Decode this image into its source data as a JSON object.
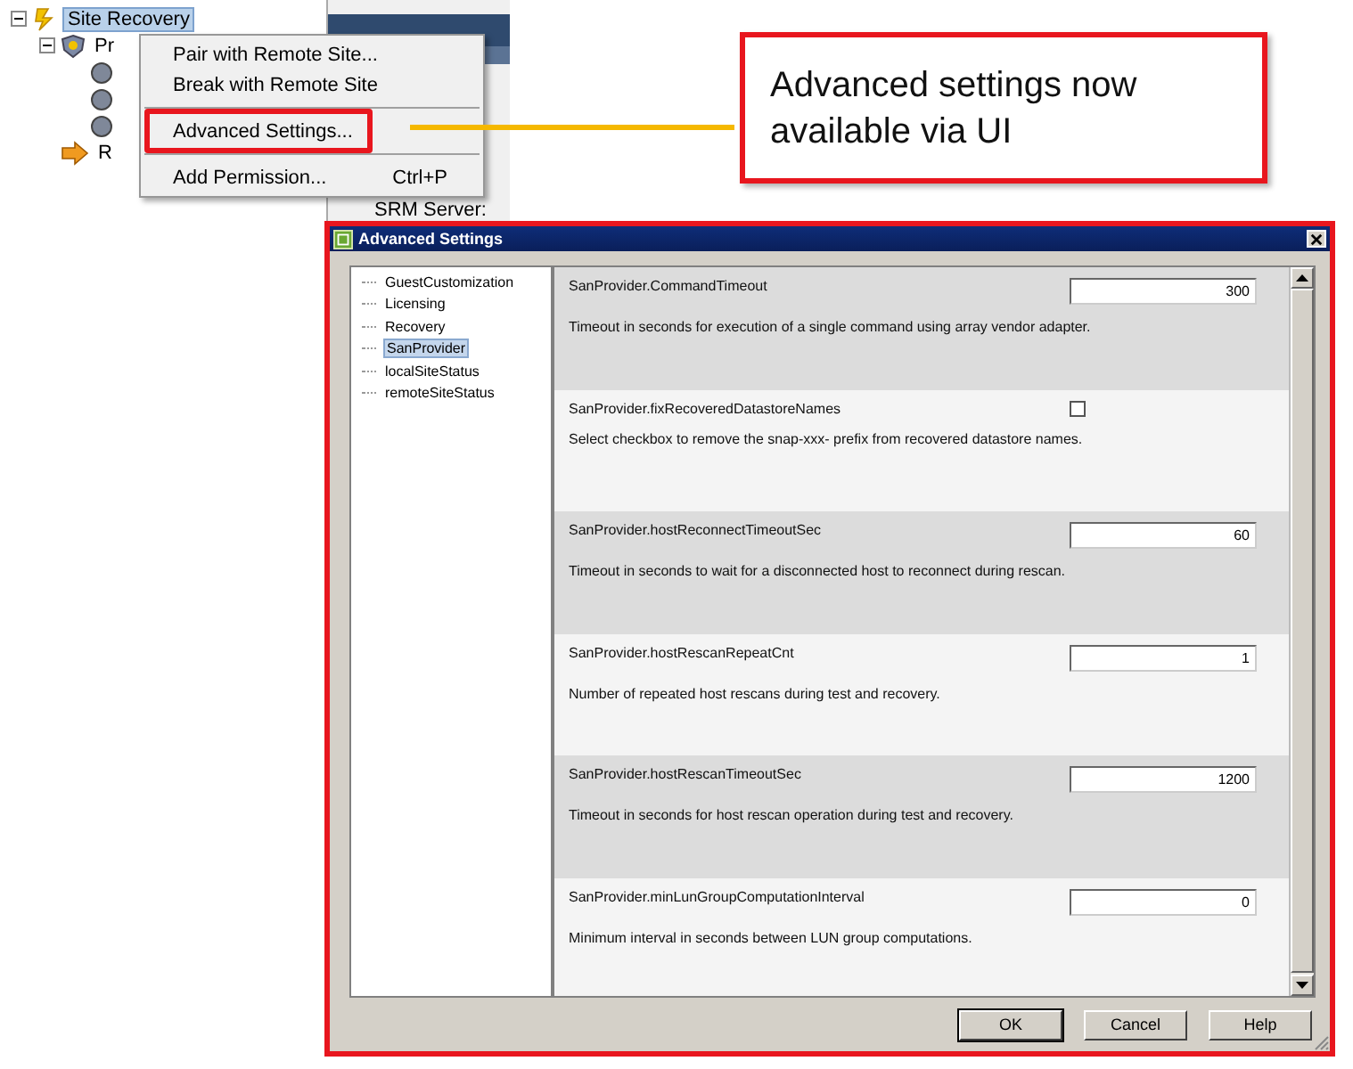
{
  "tree": {
    "items": [
      {
        "label": "Site Recovery",
        "kind": "site",
        "selected": true,
        "expanded": true,
        "children": [
          {
            "label": "Pr",
            "kind": "protection",
            "selected": false,
            "expanded": true,
            "children": [
              {
                "kind": "group"
              },
              {
                "kind": "group"
              },
              {
                "kind": "group"
              }
            ]
          },
          {
            "label": "R",
            "kind": "recovery",
            "selected": false
          }
        ]
      }
    ]
  },
  "info_panel": {
    "field_label": "SRM Server:"
  },
  "context_menu": {
    "items": [
      {
        "kind": "item",
        "label": "Pair with Remote Site...",
        "highlighted": false
      },
      {
        "kind": "item",
        "label": "Break with Remote Site",
        "highlighted": false
      },
      {
        "kind": "separator"
      },
      {
        "kind": "item",
        "label": "Advanced Settings...",
        "highlighted": true
      },
      {
        "kind": "separator"
      },
      {
        "kind": "item",
        "label": "Add Permission...",
        "shortcut": "Ctrl+P",
        "highlighted": false
      }
    ]
  },
  "callout": {
    "text": "Advanced settings now available via UI"
  },
  "dialog": {
    "title": "Advanced Settings",
    "categories": [
      {
        "label": "GuestCustomization",
        "selected": false
      },
      {
        "label": "Licensing",
        "selected": false
      },
      {
        "label": "Recovery",
        "selected": false
      },
      {
        "label": "SanProvider",
        "selected": true
      },
      {
        "label": "localSiteStatus",
        "selected": false
      },
      {
        "label": "remoteSiteStatus",
        "selected": false
      }
    ],
    "settings": [
      {
        "kind": "number",
        "name": "SanProvider.CommandTimeout",
        "value": "300",
        "description": "Timeout in seconds for execution of a single command using array vendor adapter."
      },
      {
        "kind": "checkbox",
        "name": "SanProvider.fixRecoveredDatastoreNames",
        "checked": false,
        "description": "Select checkbox to remove the snap-xxx- prefix from recovered datastore names."
      },
      {
        "kind": "number",
        "name": "SanProvider.hostReconnectTimeoutSec",
        "value": "60",
        "description": "Timeout in seconds to wait for a disconnected host to reconnect during rescan."
      },
      {
        "kind": "number",
        "name": "SanProvider.hostRescanRepeatCnt",
        "value": "1",
        "description": "Number of repeated host rescans during test and recovery."
      },
      {
        "kind": "number",
        "name": "SanProvider.hostRescanTimeoutSec",
        "value": "1200",
        "description": "Timeout in seconds for host rescan operation during test and recovery."
      },
      {
        "kind": "number",
        "name": "SanProvider.minLunGroupComputationInterval",
        "value": "0",
        "description": "Minimum interval in seconds between LUN group computations."
      }
    ],
    "buttons": [
      {
        "label": "OK",
        "default": true
      },
      {
        "label": "Cancel",
        "default": false
      },
      {
        "label": "Help",
        "default": false
      }
    ]
  }
}
